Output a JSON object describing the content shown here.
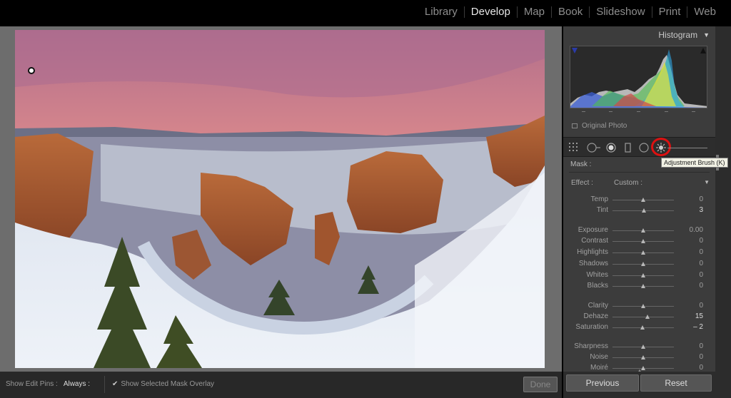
{
  "modules": {
    "items": [
      "Library",
      "Develop",
      "Map",
      "Book",
      "Slideshow",
      "Print",
      "Web"
    ],
    "active": "Develop"
  },
  "histogram": {
    "title": "Histogram",
    "original_photo_label": "Original Photo"
  },
  "tools": {
    "tooltip": "Adjustment Brush (K)",
    "icons": [
      "crop-overlay-icon",
      "spot-removal-icon",
      "red-eye-icon",
      "graduated-filter-icon",
      "radial-filter-icon",
      "adjustment-brush-icon"
    ]
  },
  "mask": {
    "label": "Mask :"
  },
  "effect": {
    "label": "Effect :",
    "value": "Custom :"
  },
  "sliders": [
    {
      "name": "temp",
      "label": "Temp",
      "value": "0",
      "pos": 0.5,
      "bright": false
    },
    {
      "name": "tint",
      "label": "Tint",
      "value": "3",
      "pos": 0.51,
      "bright": true
    },
    {
      "name": "exposure",
      "label": "Exposure",
      "value": "0.00",
      "pos": 0.5,
      "bright": false
    },
    {
      "name": "contrast",
      "label": "Contrast",
      "value": "0",
      "pos": 0.5,
      "bright": false
    },
    {
      "name": "highlights",
      "label": "Highlights",
      "value": "0",
      "pos": 0.5,
      "bright": false
    },
    {
      "name": "shadows",
      "label": "Shadows",
      "value": "0",
      "pos": 0.5,
      "bright": false
    },
    {
      "name": "whites",
      "label": "Whites",
      "value": "0",
      "pos": 0.5,
      "bright": false
    },
    {
      "name": "blacks",
      "label": "Blacks",
      "value": "0",
      "pos": 0.5,
      "bright": false
    },
    {
      "name": "clarity",
      "label": "Clarity",
      "value": "0",
      "pos": 0.5,
      "bright": false
    },
    {
      "name": "dehaze",
      "label": "Dehaze",
      "value": "15",
      "pos": 0.575,
      "bright": true
    },
    {
      "name": "saturation",
      "label": "Saturation",
      "value": "– 2",
      "pos": 0.49,
      "bright": true
    },
    {
      "name": "sharpness",
      "label": "Sharpness",
      "value": "0",
      "pos": 0.5,
      "bright": false
    },
    {
      "name": "noise",
      "label": "Noise",
      "value": "0",
      "pos": 0.5,
      "bright": false
    },
    {
      "name": "moire",
      "label": "Moiré",
      "value": "0",
      "pos": 0.5,
      "bright": false
    }
  ],
  "toolbar": {
    "show_edit_pins_label": "Show Edit Pins :",
    "show_edit_pins_value": "Always :",
    "overlay_label": "Show Selected Mask Overlay",
    "done_label": "Done"
  },
  "buttons": {
    "previous": "Previous",
    "reset": "Reset"
  }
}
